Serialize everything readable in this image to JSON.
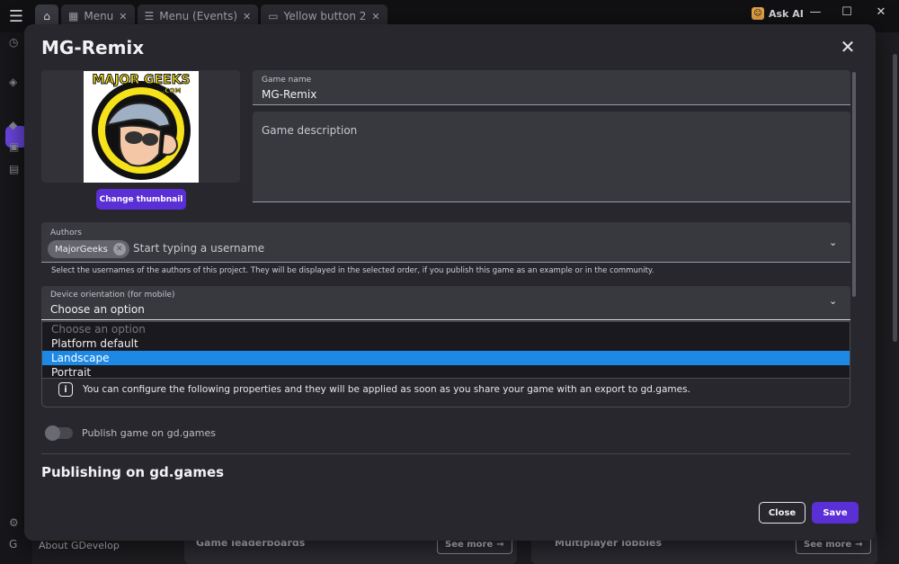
{
  "tabs": [
    {
      "label": "Menu",
      "icon": "scene-icon"
    },
    {
      "label": "Menu (Events)",
      "icon": "events-icon"
    },
    {
      "label": "Yellow button 2",
      "icon": "object-icon"
    }
  ],
  "topbar": {
    "ask_ai": "Ask AI"
  },
  "window_controls": {
    "minimize": "—",
    "maximize": "☐",
    "close": "✕"
  },
  "background": {
    "about": "About GDevelop",
    "card1_title": "Game leaderboards",
    "card2_title": "Multiplayer lobbies",
    "see_more": "See more"
  },
  "modal": {
    "title": "MG-Remix",
    "thumbnail_alt": "MAJOR GEEKS .COM",
    "change_thumbnail": "Change thumbnail",
    "game_name_label": "Game name",
    "game_name_value": "MG-Remix",
    "game_description_placeholder": "Game description",
    "authors_label": "Authors",
    "authors": [
      "MajorGeeks"
    ],
    "authors_placeholder": "Start typing a username",
    "authors_helper": "Select the usernames of the authors of this project. They will be displayed in the selected order, if you publish this game as an example or in the community.",
    "orientation_label": "Device orientation (for mobile)",
    "orientation_value": "Choose an option",
    "orientation_options": [
      "Choose an option",
      "Platform default",
      "Landscape",
      "Portrait"
    ],
    "orientation_highlighted": "Landscape",
    "info_text": "You can configure the following properties and they will be applied as soon as you share your game with an export to gd.games.",
    "publish_toggle_label": "Publish game on gd.games",
    "publish_toggle_on": false,
    "section_title": "Publishing on gd.games",
    "close_button": "Close",
    "save_button": "Save"
  },
  "colors": {
    "accent": "#5b2fd6",
    "highlight": "#1e88e5"
  }
}
